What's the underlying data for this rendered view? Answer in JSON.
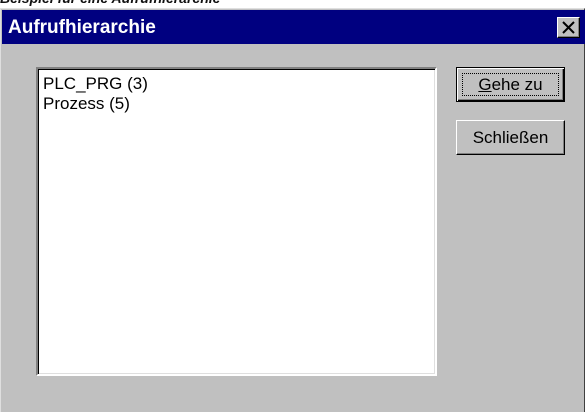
{
  "previous_caption": "Beispiel für eine Aufrufhierarchie",
  "dialog": {
    "title": "Aufrufhierarchie",
    "close_symbol": "×"
  },
  "list": {
    "items": [
      {
        "label": "PLC_PRG (3)"
      },
      {
        "label": "Prozess (5)"
      }
    ]
  },
  "buttons": {
    "goto": {
      "accel": "G",
      "rest": "ehe zu",
      "label": "Gehe zu"
    },
    "close": {
      "label": "Schließen"
    }
  },
  "icons": {
    "close": "close-icon"
  }
}
